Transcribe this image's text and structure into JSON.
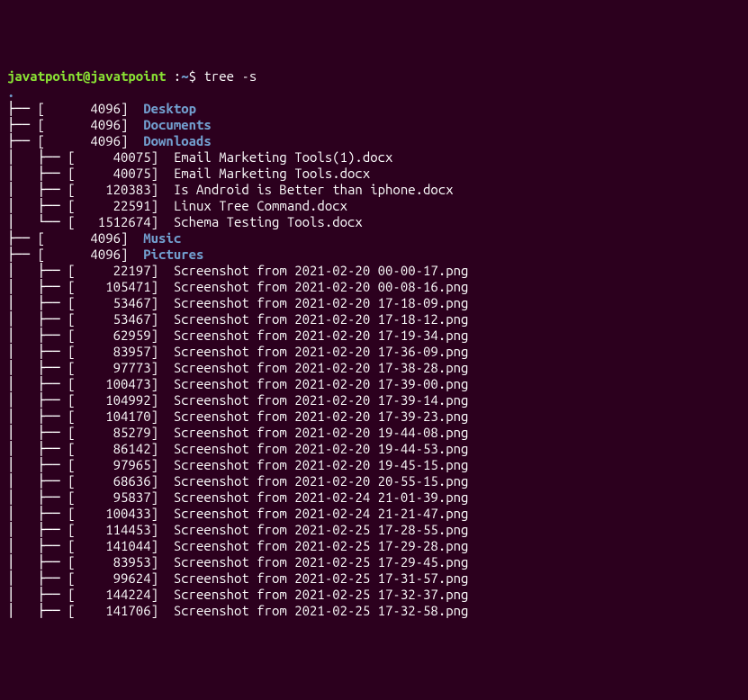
{
  "prompt": {
    "user_host": "javatpoint@javatpoint",
    "separator": " :",
    "path": "~",
    "symbol": "$ ",
    "command": "tree -s"
  },
  "root": ".",
  "tree": [
    {
      "prefix": "├── ",
      "size": "4096",
      "name": "Desktop",
      "type": "dir"
    },
    {
      "prefix": "├── ",
      "size": "4096",
      "name": "Documents",
      "type": "dir"
    },
    {
      "prefix": "├── ",
      "size": "4096",
      "name": "Downloads",
      "type": "dir"
    },
    {
      "prefix": "│   ├── ",
      "size": "40075",
      "name": "Email Marketing Tools(1).docx",
      "type": "file"
    },
    {
      "prefix": "│   ├── ",
      "size": "40075",
      "name": "Email Marketing Tools.docx",
      "type": "file"
    },
    {
      "prefix": "│   ├── ",
      "size": "120383",
      "name": "Is Android is Better than iphone.docx",
      "type": "file"
    },
    {
      "prefix": "│   ├── ",
      "size": "22591",
      "name": "Linux Tree Command.docx",
      "type": "file"
    },
    {
      "prefix": "│   └── ",
      "size": "1512674",
      "name": "Schema Testing Tools.docx",
      "type": "file"
    },
    {
      "prefix": "├── ",
      "size": "4096",
      "name": "Music",
      "type": "dir"
    },
    {
      "prefix": "├── ",
      "size": "4096",
      "name": "Pictures",
      "type": "dir"
    },
    {
      "prefix": "│   ├── ",
      "size": "22197",
      "name": "Screenshot from 2021-02-20 00-00-17.png",
      "type": "file"
    },
    {
      "prefix": "│   ├── ",
      "size": "105471",
      "name": "Screenshot from 2021-02-20 00-08-16.png",
      "type": "file"
    },
    {
      "prefix": "│   ├── ",
      "size": "53467",
      "name": "Screenshot from 2021-02-20 17-18-09.png",
      "type": "file"
    },
    {
      "prefix": "│   ├── ",
      "size": "53467",
      "name": "Screenshot from 2021-02-20 17-18-12.png",
      "type": "file"
    },
    {
      "prefix": "│   ├── ",
      "size": "62959",
      "name": "Screenshot from 2021-02-20 17-19-34.png",
      "type": "file"
    },
    {
      "prefix": "│   ├── ",
      "size": "83957",
      "name": "Screenshot from 2021-02-20 17-36-09.png",
      "type": "file"
    },
    {
      "prefix": "│   ├── ",
      "size": "97773",
      "name": "Screenshot from 2021-02-20 17-38-28.png",
      "type": "file"
    },
    {
      "prefix": "│   ├── ",
      "size": "100473",
      "name": "Screenshot from 2021-02-20 17-39-00.png",
      "type": "file"
    },
    {
      "prefix": "│   ├── ",
      "size": "104992",
      "name": "Screenshot from 2021-02-20 17-39-14.png",
      "type": "file"
    },
    {
      "prefix": "│   ├── ",
      "size": "104170",
      "name": "Screenshot from 2021-02-20 17-39-23.png",
      "type": "file"
    },
    {
      "prefix": "│   ├── ",
      "size": "85279",
      "name": "Screenshot from 2021-02-20 19-44-08.png",
      "type": "file"
    },
    {
      "prefix": "│   ├── ",
      "size": "86142",
      "name": "Screenshot from 2021-02-20 19-44-53.png",
      "type": "file"
    },
    {
      "prefix": "│   ├── ",
      "size": "97965",
      "name": "Screenshot from 2021-02-20 19-45-15.png",
      "type": "file"
    },
    {
      "prefix": "│   ├── ",
      "size": "68636",
      "name": "Screenshot from 2021-02-20 20-55-15.png",
      "type": "file"
    },
    {
      "prefix": "│   ├── ",
      "size": "95837",
      "name": "Screenshot from 2021-02-24 21-01-39.png",
      "type": "file"
    },
    {
      "prefix": "│   ├── ",
      "size": "100433",
      "name": "Screenshot from 2021-02-24 21-21-47.png",
      "type": "file"
    },
    {
      "prefix": "│   ├── ",
      "size": "114453",
      "name": "Screenshot from 2021-02-25 17-28-55.png",
      "type": "file"
    },
    {
      "prefix": "│   ├── ",
      "size": "141044",
      "name": "Screenshot from 2021-02-25 17-29-28.png",
      "type": "file"
    },
    {
      "prefix": "│   ├── ",
      "size": "83953",
      "name": "Screenshot from 2021-02-25 17-29-45.png",
      "type": "file"
    },
    {
      "prefix": "│   ├── ",
      "size": "99624",
      "name": "Screenshot from 2021-02-25 17-31-57.png",
      "type": "file"
    },
    {
      "prefix": "│   ├── ",
      "size": "144224",
      "name": "Screenshot from 2021-02-25 17-32-37.png",
      "type": "file"
    },
    {
      "prefix": "│   ├── ",
      "size": "141706",
      "name": "Screenshot from 2021-02-25 17-32-58.png",
      "type": "file"
    }
  ]
}
